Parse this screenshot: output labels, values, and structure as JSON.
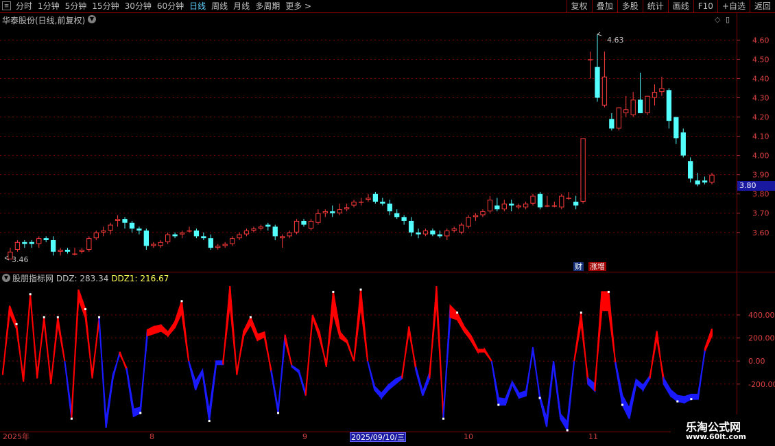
{
  "toolbar": {
    "left_items": [
      "分时",
      "1分钟",
      "5分钟",
      "15分钟",
      "30分钟",
      "60分钟",
      "日线",
      "周线",
      "月线",
      "多周期",
      "更多 >"
    ],
    "active": "日线",
    "right_items": [
      "复权",
      "叠加",
      "多股",
      "统计",
      "画线",
      "F10",
      "+自选",
      "返回"
    ],
    "menu_icon": "list-icon"
  },
  "main_chart": {
    "title": "华泰股份(日线,前复权)",
    "window_controls": "▯",
    "y_ticks": [
      "4.60",
      "4.50",
      "4.40",
      "4.30",
      "4.20",
      "4.10",
      "4.00",
      "3.90",
      "3.80",
      "3.70",
      "3.60"
    ],
    "high_label": "4.63",
    "low_label": "3.46",
    "current_price": "3.80",
    "tag_cai": "财",
    "tag_zengzeng": "涨增"
  },
  "indicator": {
    "name": "股朋指标网",
    "ddz_text": "DDZ: 283.34",
    "ddz1_text": "DDZ1: 216.67",
    "y_ticks": [
      "400.00",
      "200.00",
      "0.00",
      "-200.00"
    ]
  },
  "date_axis": {
    "labels": [
      "2025年",
      "8",
      "9",
      "10",
      "11"
    ],
    "cursor_label": "2025/09/10/三"
  },
  "watermark": {
    "line1": "乐淘公式网",
    "line2": "www.60lt.com"
  },
  "colors": {
    "up": "#ff3b3b",
    "down": "#54ffff",
    "grid": "#800000",
    "ind_pos": "#ff0000",
    "ind_neg": "#1a1aff"
  },
  "chart_data": {
    "type": "candlestick",
    "ylim": [
      3.46,
      4.63
    ],
    "candles": [
      [
        3.46,
        3.52,
        3.46,
        3.5
      ],
      [
        3.51,
        3.56,
        3.5,
        3.55
      ],
      [
        3.55,
        3.56,
        3.52,
        3.54
      ],
      [
        3.55,
        3.56,
        3.52,
        3.54
      ],
      [
        3.54,
        3.58,
        3.52,
        3.57
      ],
      [
        3.57,
        3.58,
        3.55,
        3.56
      ],
      [
        3.56,
        3.58,
        3.48,
        3.5
      ],
      [
        3.5,
        3.52,
        3.48,
        3.51
      ],
      [
        3.51,
        3.52,
        3.49,
        3.5
      ],
      [
        3.49,
        3.52,
        3.48,
        3.49
      ],
      [
        3.5,
        3.52,
        3.49,
        3.51
      ],
      [
        3.51,
        3.58,
        3.5,
        3.57
      ],
      [
        3.57,
        3.61,
        3.56,
        3.6
      ],
      [
        3.6,
        3.63,
        3.58,
        3.61
      ],
      [
        3.61,
        3.65,
        3.59,
        3.64
      ],
      [
        3.66,
        3.69,
        3.63,
        3.67
      ],
      [
        3.67,
        3.68,
        3.62,
        3.65
      ],
      [
        3.65,
        3.66,
        3.6,
        3.62
      ],
      [
        3.62,
        3.63,
        3.59,
        3.61
      ],
      [
        3.61,
        3.62,
        3.51,
        3.53
      ],
      [
        3.53,
        3.55,
        3.52,
        3.54
      ],
      [
        3.53,
        3.56,
        3.52,
        3.55
      ],
      [
        3.55,
        3.6,
        3.54,
        3.59
      ],
      [
        3.59,
        3.6,
        3.57,
        3.58
      ],
      [
        3.59,
        3.61,
        3.57,
        3.6
      ],
      [
        3.61,
        3.63,
        3.6,
        3.61
      ],
      [
        3.61,
        3.62,
        3.57,
        3.58
      ],
      [
        3.58,
        3.6,
        3.56,
        3.57
      ],
      [
        3.57,
        3.59,
        3.51,
        3.52
      ],
      [
        3.52,
        3.54,
        3.51,
        3.53
      ],
      [
        3.53,
        3.55,
        3.52,
        3.54
      ],
      [
        3.54,
        3.58,
        3.53,
        3.57
      ],
      [
        3.57,
        3.6,
        3.56,
        3.59
      ],
      [
        3.59,
        3.62,
        3.58,
        3.61
      ],
      [
        3.61,
        3.63,
        3.6,
        3.62
      ],
      [
        3.62,
        3.64,
        3.61,
        3.63
      ],
      [
        3.64,
        3.65,
        3.61,
        3.63
      ],
      [
        3.63,
        3.64,
        3.56,
        3.58
      ],
      [
        3.57,
        3.59,
        3.52,
        3.58
      ],
      [
        3.58,
        3.61,
        3.57,
        3.6
      ],
      [
        3.6,
        3.67,
        3.59,
        3.66
      ],
      [
        3.66,
        3.67,
        3.63,
        3.64
      ],
      [
        3.62,
        3.67,
        3.61,
        3.66
      ],
      [
        3.65,
        3.72,
        3.64,
        3.7
      ],
      [
        3.7,
        3.72,
        3.68,
        3.71
      ],
      [
        3.71,
        3.74,
        3.68,
        3.7
      ],
      [
        3.7,
        3.75,
        3.69,
        3.72
      ],
      [
        3.72,
        3.75,
        3.71,
        3.73
      ],
      [
        3.74,
        3.77,
        3.73,
        3.76
      ],
      [
        3.76,
        3.78,
        3.74,
        3.76
      ],
      [
        3.77,
        3.8,
        3.76,
        3.78
      ],
      [
        3.8,
        3.81,
        3.75,
        3.76
      ],
      [
        3.76,
        3.78,
        3.74,
        3.75
      ],
      [
        3.75,
        3.77,
        3.69,
        3.71
      ],
      [
        3.7,
        3.72,
        3.67,
        3.68
      ],
      [
        3.68,
        3.69,
        3.64,
        3.66
      ],
      [
        3.66,
        3.68,
        3.58,
        3.6
      ],
      [
        3.6,
        3.62,
        3.57,
        3.59
      ],
      [
        3.59,
        3.62,
        3.58,
        3.61
      ],
      [
        3.61,
        3.62,
        3.58,
        3.59
      ],
      [
        3.59,
        3.61,
        3.57,
        3.58
      ],
      [
        3.58,
        3.62,
        3.56,
        3.61
      ],
      [
        3.61,
        3.63,
        3.6,
        3.62
      ],
      [
        3.6,
        3.65,
        3.59,
        3.64
      ],
      [
        3.63,
        3.69,
        3.62,
        3.68
      ],
      [
        3.68,
        3.7,
        3.66,
        3.69
      ],
      [
        3.69,
        3.72,
        3.68,
        3.71
      ],
      [
        3.71,
        3.79,
        3.7,
        3.77
      ],
      [
        3.74,
        3.78,
        3.71,
        3.72
      ],
      [
        3.72,
        3.77,
        3.71,
        3.75
      ],
      [
        3.75,
        3.77,
        3.71,
        3.74
      ],
      [
        3.73,
        3.75,
        3.72,
        3.74
      ],
      [
        3.73,
        3.76,
        3.72,
        3.75
      ],
      [
        3.75,
        3.8,
        3.74,
        3.79
      ],
      [
        3.8,
        3.81,
        3.72,
        3.73
      ],
      [
        3.74,
        3.79,
        3.73,
        3.74
      ],
      [
        3.74,
        3.76,
        3.73,
        3.74
      ],
      [
        3.73,
        3.8,
        3.72,
        3.79
      ],
      [
        3.78,
        3.81,
        3.77,
        3.78
      ],
      [
        3.76,
        3.79,
        3.72,
        3.74
      ],
      [
        3.76,
        4.09,
        3.75,
        4.09
      ],
      [
        4.5,
        4.54,
        4.4,
        4.5
      ],
      [
        4.46,
        4.63,
        4.28,
        4.3
      ],
      [
        4.26,
        4.54,
        4.25,
        4.41
      ],
      [
        4.19,
        4.22,
        4.13,
        4.14
      ],
      [
        4.14,
        4.25,
        4.13,
        4.25
      ],
      [
        4.22,
        4.31,
        4.2,
        4.24
      ],
      [
        4.21,
        4.33,
        4.2,
        4.29
      ],
      [
        4.29,
        4.43,
        4.22,
        4.22
      ],
      [
        4.22,
        4.31,
        4.21,
        4.31
      ],
      [
        4.3,
        4.37,
        4.26,
        4.33
      ],
      [
        4.33,
        4.41,
        4.31,
        4.35
      ],
      [
        4.34,
        4.35,
        4.14,
        4.18
      ],
      [
        4.2,
        4.2,
        4.06,
        4.09
      ],
      [
        4.12,
        4.14,
        3.99,
        4.0
      ],
      [
        3.97,
        3.99,
        3.86,
        3.88
      ],
      [
        3.87,
        3.91,
        3.84,
        3.85
      ],
      [
        3.87,
        3.89,
        3.85,
        3.86
      ],
      [
        3.86,
        3.91,
        3.85,
        3.9
      ]
    ],
    "indicator_values": [
      [
        -120,
        -100
      ],
      [
        480,
        420
      ],
      [
        320,
        280
      ],
      [
        -180,
        -150
      ],
      [
        580,
        560
      ],
      [
        -150,
        -120
      ],
      [
        380,
        350
      ],
      [
        -200,
        -180
      ],
      [
        380,
        330
      ],
      [
        0,
        0
      ],
      [
        -500,
        -450
      ],
      [
        620,
        540
      ],
      [
        450,
        380
      ],
      [
        -150,
        -120
      ],
      [
        380,
        350
      ],
      [
        -580,
        -520
      ],
      [
        -150,
        -120
      ],
      [
        80,
        60
      ],
      [
        -80,
        -60
      ],
      [
        -480,
        -420
      ],
      [
        -450,
        -400
      ],
      [
        270,
        220
      ],
      [
        300,
        240
      ],
      [
        310,
        260
      ],
      [
        250,
        220
      ],
      [
        340,
        290
      ],
      [
        520,
        420
      ],
      [
        0,
        0
      ],
      [
        -250,
        -180
      ],
      [
        -100,
        -80
      ],
      [
        -520,
        -440
      ],
      [
        -30,
        0
      ],
      [
        -30,
        0
      ],
      [
        650,
        500
      ],
      [
        -120,
        -100
      ],
      [
        260,
        220
      ],
      [
        380,
        320
      ],
      [
        230,
        180
      ],
      [
        250,
        210
      ],
      [
        -100,
        -80
      ],
      [
        -450,
        -420
      ],
      [
        230,
        180
      ],
      [
        -50,
        -40
      ],
      [
        -100,
        -80
      ],
      [
        -300,
        -280
      ],
      [
        400,
        380
      ],
      [
        250,
        200
      ],
      [
        -50,
        -20
      ],
      [
        600,
        420
      ],
      [
        250,
        200
      ],
      [
        180,
        160
      ],
      [
        0,
        0
      ],
      [
        620,
        480
      ],
      [
        0,
        0
      ],
      [
        -250,
        -220
      ],
      [
        -320,
        -280
      ],
      [
        -250,
        -210
      ],
      [
        -200,
        -160
      ],
      [
        -150,
        -130
      ],
      [
        300,
        260
      ],
      [
        -80,
        -50
      ],
      [
        -300,
        -270
      ],
      [
        -150,
        -100
      ],
      [
        650,
        520
      ],
      [
        -500,
        -460
      ],
      [
        480,
        380
      ],
      [
        420,
        360
      ],
      [
        300,
        260
      ],
      [
        220,
        180
      ],
      [
        100,
        80
      ],
      [
        100,
        80
      ],
      [
        0,
        0
      ],
      [
        -380,
        -320
      ],
      [
        -380,
        -330
      ],
      [
        -200,
        -180
      ],
      [
        -320,
        -280
      ],
      [
        -300,
        -260
      ],
      [
        120,
        90
      ],
      [
        -320,
        -300
      ],
      [
        -570,
        -500
      ],
      [
        -30,
        0
      ],
      [
        -500,
        -460
      ],
      [
        -600,
        -530
      ],
      [
        0,
        0
      ],
      [
        420,
        330
      ],
      [
        -200,
        -150
      ],
      [
        -260,
        -200
      ],
      [
        600,
        440
      ],
      [
        600,
        440
      ],
      [
        -30,
        -10
      ],
      [
        -380,
        -300
      ],
      [
        -500,
        -410
      ],
      [
        -200,
        -160
      ],
      [
        -250,
        -210
      ],
      [
        -150,
        -130
      ],
      [
        260,
        200
      ],
      [
        -200,
        -150
      ],
      [
        -300,
        -250
      ],
      [
        -350,
        -300
      ],
      [
        -360,
        -310
      ],
      [
        -330,
        -290
      ],
      [
        -330,
        -290
      ],
      [
        110,
        90
      ],
      [
        280,
        220
      ]
    ]
  }
}
